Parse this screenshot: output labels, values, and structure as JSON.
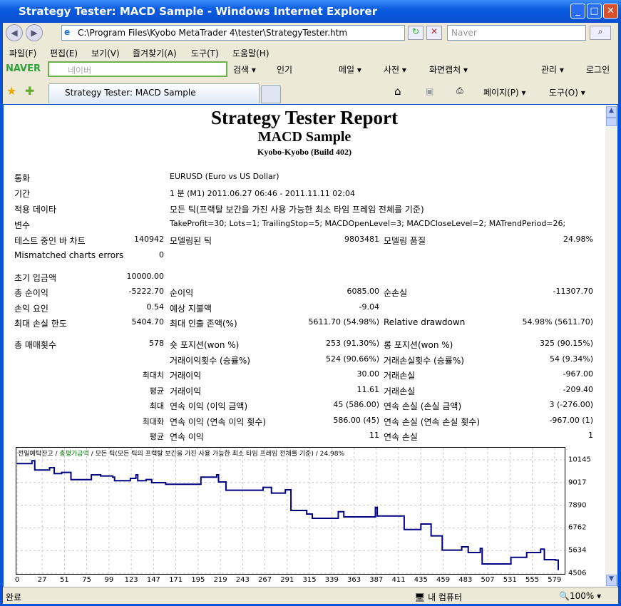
{
  "window": {
    "title": "Strategy Tester: MACD Sample - Windows Internet Explorer",
    "min": "_",
    "max": "□",
    "close": "✕"
  },
  "address": {
    "url": "C:\\Program Files\\Kyobo MetaTrader 4\\tester\\StrategyTester.htm",
    "search_placeholder": "Naver"
  },
  "menu": [
    "파일(F)",
    "편집(E)",
    "보기(V)",
    "즐겨찾기(A)",
    "도구(T)",
    "도움말(H)"
  ],
  "naver": {
    "logo": "NAVER",
    "placeholder": "네이버",
    "items": [
      "검색 ▾",
      "인기",
      "메일 ▾",
      "사전 ▾",
      "화면캡처 ▾",
      "관리 ▾",
      "로그인"
    ]
  },
  "tab": {
    "label": "Strategy Tester: MACD Sample",
    "page": "페이지(P) ▾",
    "tools": "도구(O) ▾"
  },
  "report": {
    "title": "Strategy Tester Report",
    "subtitle": "MACD Sample",
    "build": "Kyobo-Kyobo (Build 402)"
  },
  "rows": [
    {
      "y": 241,
      "cells": [
        "통화",
        "",
        "EURUSD (Euro vs US Dollar)",
        "",
        "",
        ""
      ]
    },
    {
      "y": 263,
      "cells": [
        "기간",
        "",
        "1 분 (M1) 2011.06.27 06:46 - 2011.11.11 02:04",
        "",
        "",
        ""
      ]
    },
    {
      "y": 285,
      "cells": [
        "적용 데이타",
        "",
        "모든 틱(프랙탈 보간을 가진 사용 가능한 최소 타임 프레임 전체를 기준)",
        "",
        "",
        ""
      ]
    },
    {
      "y": 307,
      "cells": [
        "변수",
        "",
        "TakeProfit=30; Lots=1; TrailingStop=5; MACDOpenLevel=3; MACDCloseLevel=2; MATrendPeriod=26;",
        "",
        "",
        ""
      ]
    },
    {
      "y": 329,
      "cells": [
        "테스트 중인 바 차트",
        "140942",
        "모델링된 틱",
        "9803481",
        "모델링 품질",
        "24.98%"
      ]
    },
    {
      "y": 351,
      "cells": [
        "Mismatched charts errors",
        "0",
        "",
        "",
        "",
        ""
      ]
    },
    {
      "y": 381,
      "cells": [
        "초기 입금액",
        "10000.00",
        "",
        "",
        "",
        ""
      ]
    },
    {
      "y": 402,
      "cells": [
        "총 순이익",
        "-5222.70",
        "순이익",
        "6085.00",
        "순손실",
        "-11307.70"
      ]
    },
    {
      "y": 424,
      "cells": [
        "손익 요인",
        "0.54",
        "예상 지불액",
        "-9.04",
        "",
        ""
      ]
    },
    {
      "y": 445,
      "cells": [
        "최대 손실 한도",
        "5404.70",
        "최대 인출 존액(%)",
        "5611.70 (54.98%)",
        "Relative drawdown",
        "54.98% (5611.70)"
      ]
    },
    {
      "y": 475,
      "cells": [
        "총 매매횟수",
        "578",
        "숏 포지션(won %)",
        "253 (91.30%)",
        "롱 포지션(won %)",
        "325 (90.15%)"
      ]
    },
    {
      "y": 497,
      "cells": [
        "",
        "",
        "거래이익횟수 (승률%)",
        "524 (90.66%)",
        "거래손실횟수 (승률%)",
        "54 (9.34%)"
      ]
    },
    {
      "y": 518,
      "cells": [
        "",
        "최대치",
        "거래이익",
        "30.00",
        "거래손실",
        "-967.00"
      ]
    },
    {
      "y": 540,
      "cells": [
        "",
        "평균",
        "거래이익",
        "11.61",
        "거래손실",
        "-209.40"
      ]
    },
    {
      "y": 561,
      "cells": [
        "",
        "최대",
        "연속 이익 (이익 금액)",
        "45 (586.00)",
        "연속 손실 (손실 금액)",
        "3 (-276.00)"
      ]
    },
    {
      "y": 583,
      "cells": [
        "",
        "최대화",
        "연속 이익 (연속 이익 횟수)",
        "586.00 (45)",
        "연속 손실 (연속 손실 횟수)",
        "-967.00 (1)"
      ]
    },
    {
      "y": 604,
      "cells": [
        "",
        "평균",
        "연속 이익",
        "11",
        "연속 손실",
        "1"
      ]
    }
  ],
  "chart_data": {
    "type": "line",
    "legend": {
      "balance": "전일예탁잔고",
      "sep1": " / ",
      "equity": "총평가금액",
      "rest": " / 모든 틱(모든 틱의 프랙탈 보간을 가진 사용 가능한 최소 타임 프레임 전체를 기준) / 24.98%"
    },
    "xticks": [
      0,
      27,
      51,
      75,
      99,
      123,
      147,
      171,
      195,
      219,
      243,
      267,
      291,
      315,
      339,
      363,
      387,
      411,
      435,
      459,
      483,
      507,
      531,
      555,
      579
    ],
    "yticks": [
      10145,
      9017,
      7890,
      6762,
      5634,
      4506
    ],
    "xlim": [
      0,
      583
    ],
    "ylim": [
      4506,
      10145
    ],
    "grid": true,
    "line_color": "#000080",
    "equity_color": "#008000",
    "x": [
      0,
      16,
      19,
      35,
      40,
      48,
      58,
      80,
      90,
      103,
      105,
      122,
      128,
      130,
      139,
      145,
      160,
      198,
      215,
      217,
      225,
      265,
      274,
      289,
      295,
      312,
      318,
      346,
      352,
      386,
      388,
      417,
      435,
      446,
      458,
      479,
      486,
      499,
      501,
      532,
      549,
      564,
      568,
      580,
      583
    ],
    "y": [
      9958,
      10100,
      9638,
      9756,
      9461,
      9520,
      9163,
      9401,
      9342,
      9284,
      9106,
      9224,
      9401,
      9106,
      9165,
      9011,
      8929,
      9284,
      9401,
      9046,
      8632,
      8773,
      8490,
      8656,
      7627,
      7451,
      7237,
      7567,
      7308,
      7780,
      7354,
      6680,
      6954,
      6362,
      5652,
      5819,
      5535,
      5737,
      4967,
      5297,
      5535,
      5701,
      5180,
      5157,
      4673
    ]
  },
  "status": {
    "left": "완료",
    "zone": "내 컴퓨터",
    "zoom": "100%"
  }
}
